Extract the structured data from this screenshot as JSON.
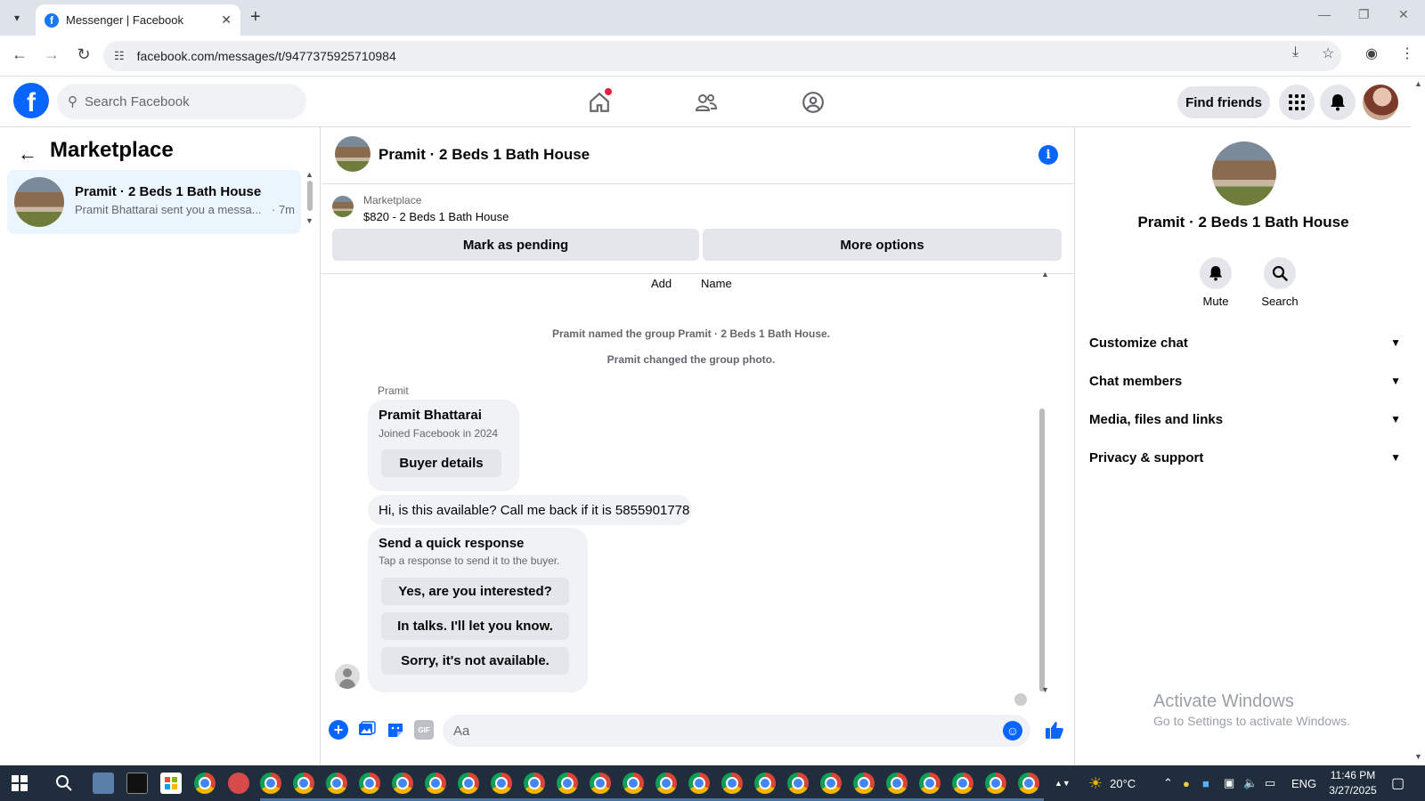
{
  "browser": {
    "tab_title": "Messenger | Facebook",
    "url": "facebook.com/messages/t/9477375925710984"
  },
  "fb_header": {
    "search_placeholder": "Search Facebook",
    "find_friends": "Find friends"
  },
  "left": {
    "title": "Marketplace",
    "conversations": [
      {
        "name": "Pramit · 2 Beds 1 Bath House",
        "snippet": "Pramit Bhattarai sent you a messa...",
        "time": "· 7m"
      }
    ]
  },
  "chat": {
    "title": "Pramit · 2 Beds 1 Bath House",
    "marketplace_label": "Marketplace",
    "listing": "$820 - 2 Beds 1 Bath House",
    "mark_pending": "Mark as pending",
    "more_options": "More options",
    "header_add": "Add",
    "header_name": "Name",
    "system_messages": [
      "Pramit named the group Pramit · 2 Beds 1 Bath House.",
      "Pramit changed the group photo."
    ],
    "sender": "Pramit",
    "buyer_card": {
      "name": "Pramit Bhattarai",
      "sub": "Joined Facebook in 2024",
      "button": "Buyer details"
    },
    "message": "Hi, is this available? Call me back if it is 5855901778",
    "quick": {
      "title": "Send a quick response",
      "sub": "Tap a response to send it to the buyer.",
      "options": [
        "Yes, are you interested?",
        "In talks. I'll let you know.",
        "Sorry, it's not available."
      ]
    },
    "composer_placeholder": "Aa"
  },
  "right": {
    "name": "Pramit · 2 Beds 1 Bath House",
    "mute": "Mute",
    "search": "Search",
    "sections": [
      "Customize chat",
      "Chat members",
      "Media, files and links",
      "Privacy & support"
    ]
  },
  "watermark": {
    "line1": "Activate Windows",
    "line2": "Go to Settings to activate Windows."
  },
  "taskbar": {
    "weather": "20°C",
    "lang": "ENG",
    "time": "11:46 PM",
    "date": "3/27/2025"
  }
}
